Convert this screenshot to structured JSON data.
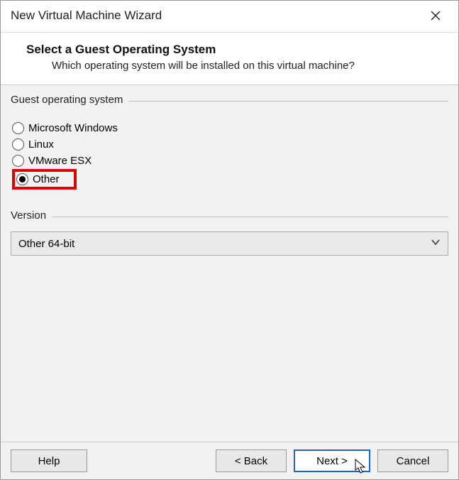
{
  "window": {
    "title": "New Virtual Machine Wizard"
  },
  "header": {
    "heading": "Select a Guest Operating System",
    "subheading": "Which operating system will be installed on this virtual machine?"
  },
  "guest_os": {
    "group_label": "Guest operating system",
    "options": [
      {
        "label": "Microsoft Windows",
        "selected": false
      },
      {
        "label": "Linux",
        "selected": false
      },
      {
        "label": "VMware ESX",
        "selected": false
      },
      {
        "label": "Other",
        "selected": true
      }
    ]
  },
  "version": {
    "group_label": "Version",
    "selected": "Other 64-bit"
  },
  "buttons": {
    "help": "Help",
    "back": "< Back",
    "next": "Next >",
    "cancel": "Cancel"
  }
}
